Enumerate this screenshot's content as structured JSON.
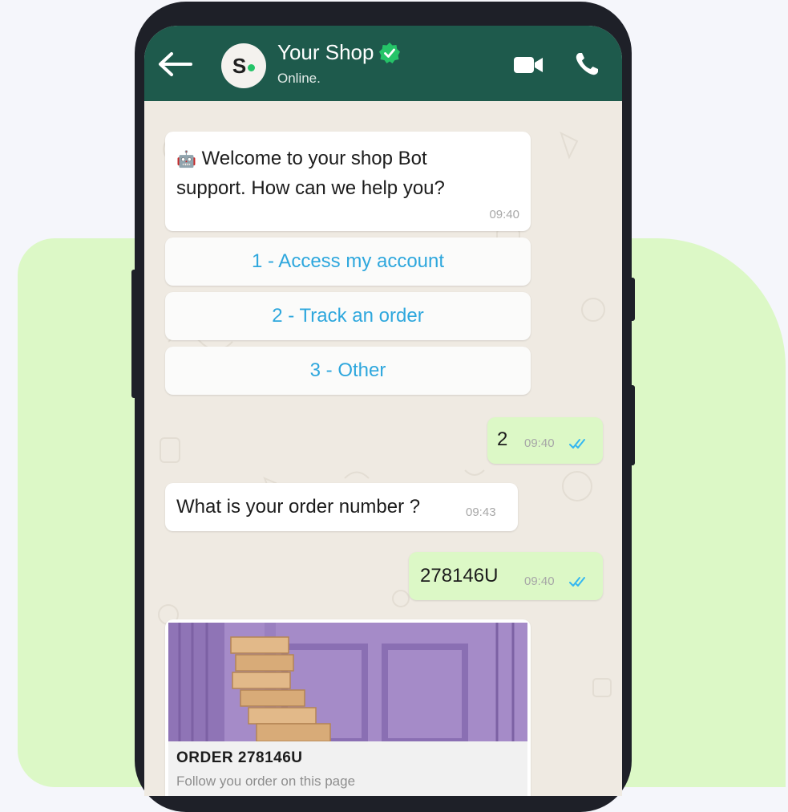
{
  "chat_header": {
    "title": "Your Shop",
    "status": "Online.",
    "avatar_letter": "S",
    "icons": [
      "back-arrow-icon",
      "verified-icon",
      "video-camera-icon",
      "phone-icon"
    ]
  },
  "messages": {
    "welcome": {
      "emoji": "🤖",
      "line1": "Welcome to your shop Bot",
      "line2": "support. How can we help you?",
      "time": "09:40"
    },
    "options": [
      "1 - Access my account",
      "2 - Track an order",
      "3 - Other"
    ],
    "reply_choice": {
      "text": "2",
      "time": "09:40"
    },
    "order_question": {
      "text": "What is your order number ?",
      "time": "09:43"
    },
    "reply_order": {
      "text": "278146U",
      "time": "09:40"
    },
    "order_card": {
      "title": "ORDER  278146U",
      "subtitle": "Follow you order on this page"
    }
  },
  "colors": {
    "header": "#1e5a4c",
    "chat_background": "#efeae2",
    "outgoing_bubble": "#dcf8c6",
    "option_text": "#2ea7dd",
    "verified_badge": "#25c468",
    "read_ticks": "#34b7f1",
    "backdrop_blob": "#dcf8c6"
  }
}
